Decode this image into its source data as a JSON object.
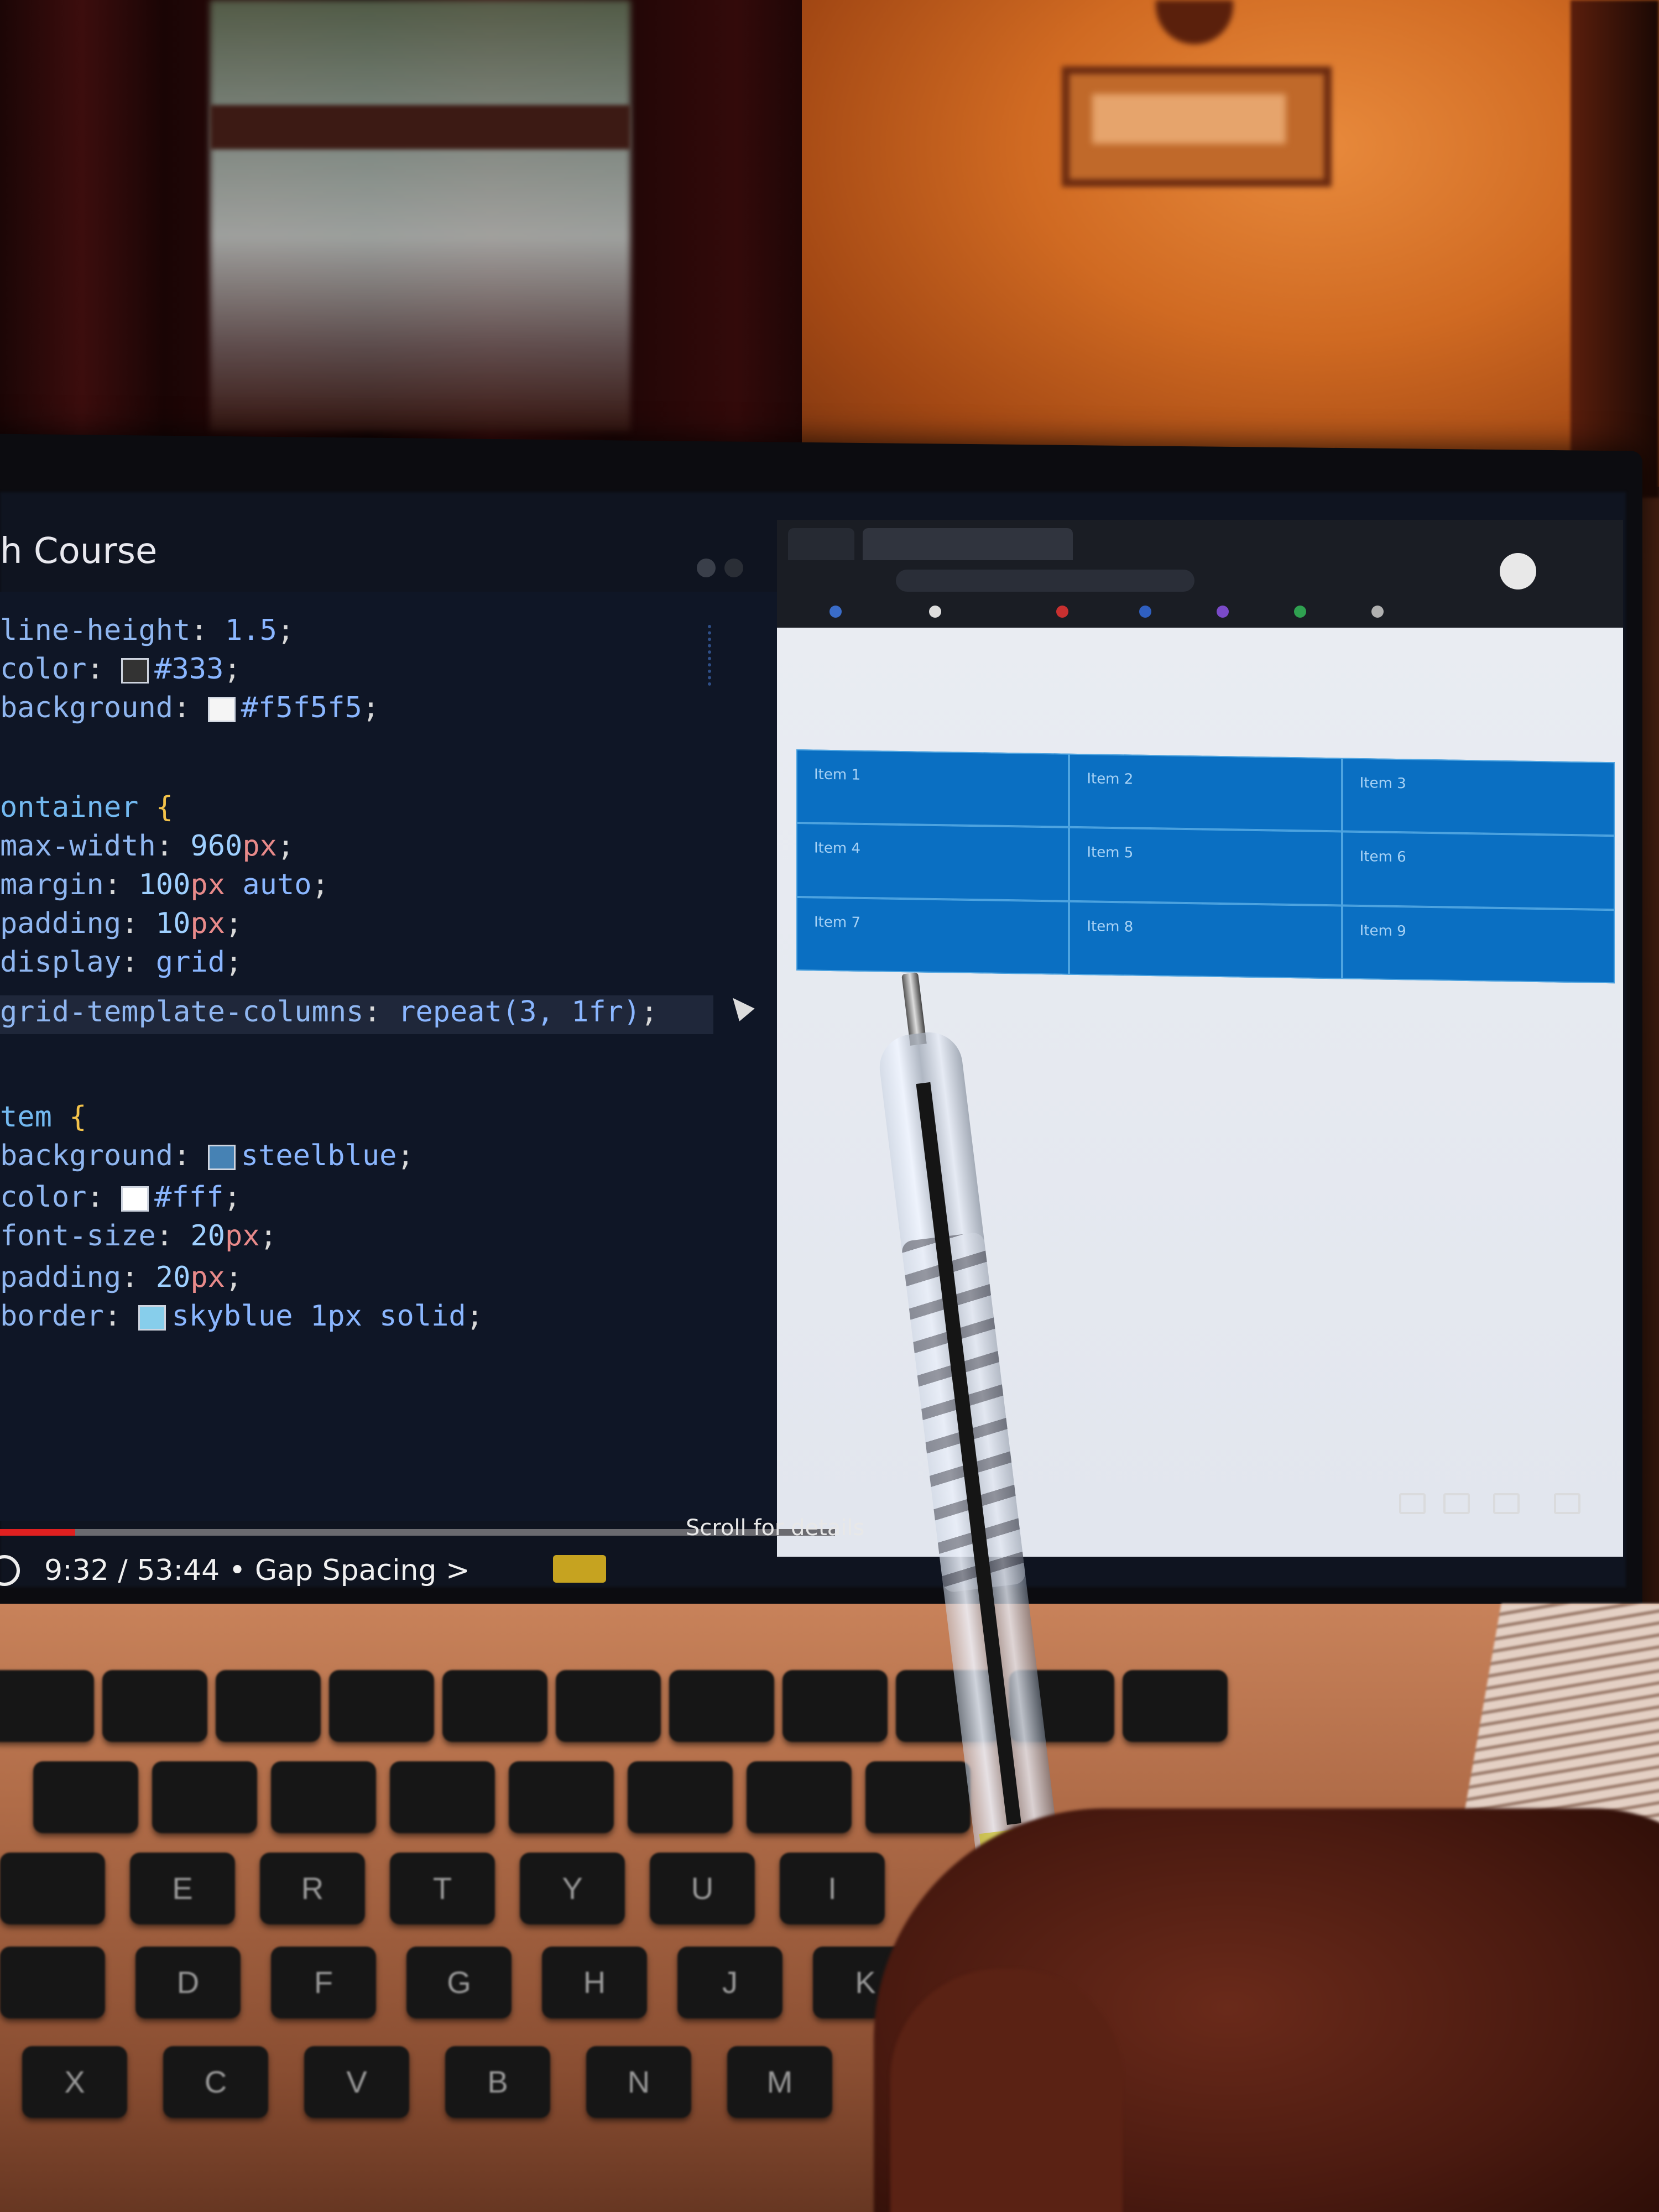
{
  "video": {
    "title": "h Course",
    "time": "9:32 / 53:44 • Gap Spacing >",
    "scroll_hint": "Scroll for details",
    "progress_fraction": 0.09
  },
  "editor": {
    "lines": [
      {
        "prop": "line-height",
        "value": "1.5",
        "kind": "plain"
      },
      {
        "prop": "color",
        "value": "#333",
        "kind": "swatch",
        "swatch": "#333333"
      },
      {
        "prop": "background",
        "value": "#f5f5f5",
        "kind": "swatch",
        "swatch": "#f5f5f5"
      },
      {
        "selector": "ontainer",
        "kind": "selector"
      },
      {
        "prop": "max-width",
        "value": "960",
        "unit": "px",
        "kind": "unit"
      },
      {
        "prop": "margin",
        "value": "100",
        "unit": "px",
        "rest": "auto",
        "kind": "unit-rest"
      },
      {
        "prop": "padding",
        "value": "10",
        "unit": "px",
        "kind": "unit"
      },
      {
        "prop": "display",
        "value": "grid",
        "kind": "plain"
      },
      {
        "prop": "grid-template-columns",
        "value": "repeat(3, 1fr)",
        "kind": "plain"
      },
      {
        "selector": "tem",
        "kind": "selector"
      },
      {
        "prop": "background",
        "value": "steelblue",
        "kind": "swatch",
        "swatch": "#4682b4"
      },
      {
        "prop": "color",
        "value": "#fff",
        "kind": "swatch",
        "swatch": "#ffffff"
      },
      {
        "prop": "font-size",
        "value": "20",
        "unit": "px",
        "kind": "unit"
      },
      {
        "prop": "padding",
        "value": "20",
        "unit": "px",
        "kind": "unit"
      },
      {
        "prop": "border",
        "value": "skyblue 1px solid",
        "kind": "swatch",
        "swatch": "#87ceeb"
      }
    ]
  },
  "grid_items": [
    "Item 1",
    "Item 2",
    "Item 3",
    "Item 4",
    "Item 5",
    "Item 6",
    "Item 7",
    "Item 8",
    "Item 9"
  ],
  "keyboard": {
    "row1": [
      "",
      "",
      "",
      "",
      "",
      "",
      "",
      "",
      "",
      "",
      ""
    ],
    "row2": [
      "",
      "",
      "",
      "",
      "",
      "",
      "",
      ""
    ],
    "row3": [
      "",
      "E",
      "R",
      "T",
      "Y",
      "U",
      "I"
    ],
    "row4": [
      "",
      "D",
      "F",
      "G",
      "H",
      "J",
      "K"
    ],
    "row5": [
      "X",
      "C",
      "V",
      "B",
      "N",
      "M"
    ]
  },
  "colors": {
    "grid_item": "#0a6fc2",
    "progress": "#e02020",
    "editor_bg": "#0f1626"
  }
}
